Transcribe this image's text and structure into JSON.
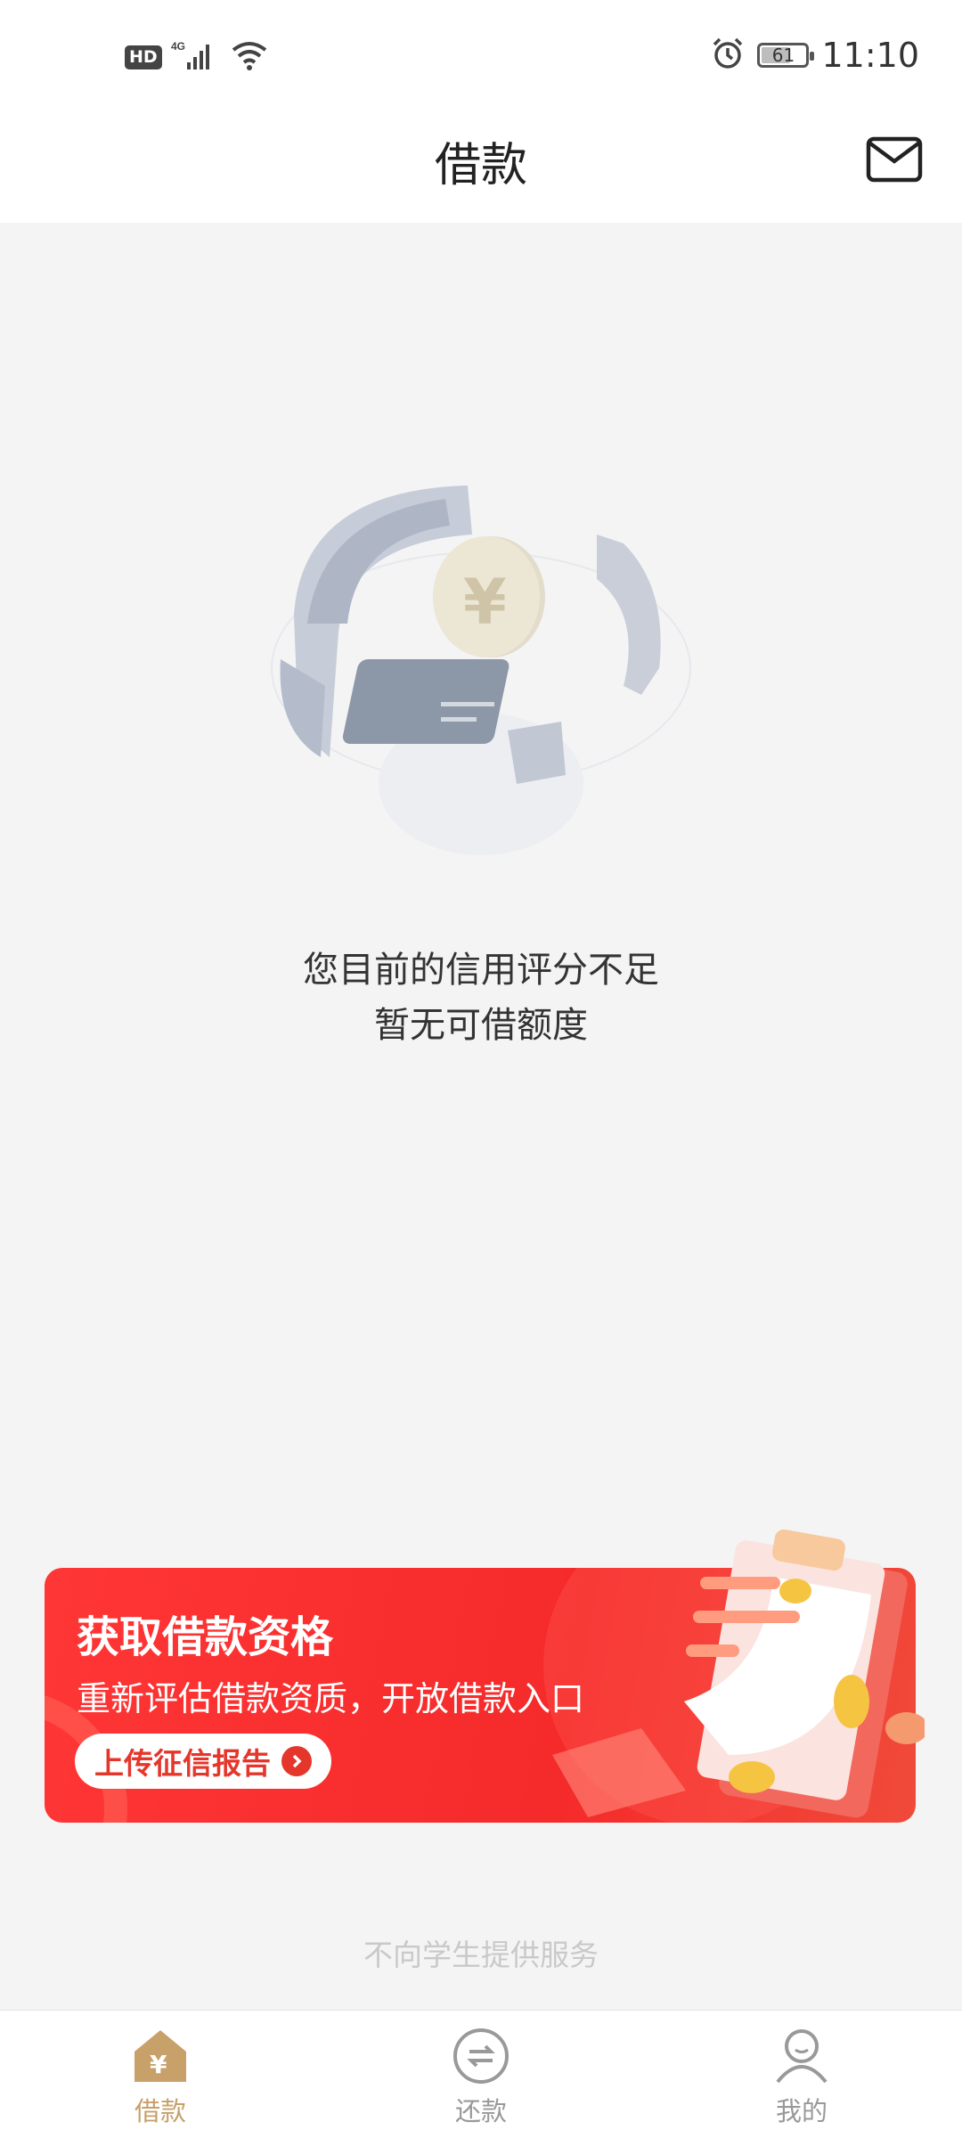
{
  "status_bar": {
    "network_badge": "HD",
    "network_type": "4G",
    "battery_level": 61,
    "battery_text": "61",
    "time": "11:10"
  },
  "header": {
    "title": "借款",
    "mail_icon": "mail-icon"
  },
  "hero": {
    "illustration": "coin-card-illustration"
  },
  "message": {
    "line1": "您目前的信用评分不足",
    "line2": "暂无可借额度"
  },
  "banner": {
    "title": "获取借款资格",
    "subtitle": "重新评估借款资质，开放借款入口",
    "button_label": "上传征信报告",
    "button_icon": "chevron-right-icon",
    "colors": {
      "bg": "#f52a2a",
      "button_text": "#e5362b"
    }
  },
  "notice": "不向学生提供服务",
  "tabbar": {
    "items": [
      {
        "label": "借款",
        "icon": "loan-home-icon",
        "active": true
      },
      {
        "label": "还款",
        "icon": "repay-exchange-icon",
        "active": false
      },
      {
        "label": "我的",
        "icon": "profile-icon",
        "active": false
      }
    ],
    "active_color": "#c7a06a",
    "inactive_color": "#999999"
  }
}
